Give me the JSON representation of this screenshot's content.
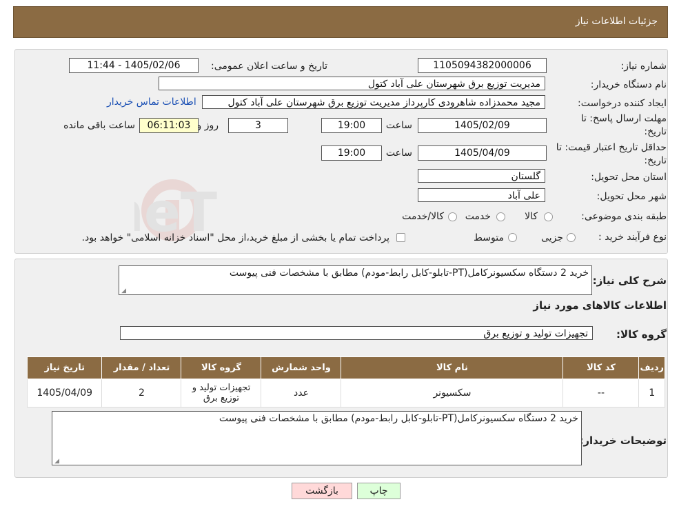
{
  "header": {
    "title": "جزئیات اطلاعات نیاز"
  },
  "fields": {
    "need_number_label": "شماره نیاز:",
    "need_number": "1105094382000006",
    "announce_label": "تاریخ و ساعت اعلان عمومی:",
    "announce_value": "1405/02/06 - 11:44",
    "buyer_org_label": "نام دستگاه خریدار:",
    "buyer_org": "مدیریت توزیع برق شهرستان علی آباد کتول",
    "requester_label": "ایجاد کننده درخواست:",
    "requester": "مجید محمدزاده شاهرودی کارپرداز مدیریت توزیع برق شهرستان علی آباد کتول",
    "contact_link": "اطلاعات تماس خریدار",
    "deadline_label_1": "مهلت ارسال پاسخ: تا",
    "deadline_label_2": "تاریخ:",
    "deadline_date": "1405/02/09",
    "time_label": "ساعت",
    "deadline_time": "19:00",
    "days_value": "3",
    "days_label": "روز و",
    "remaining_time": "06:11:03",
    "remaining_label": "ساعت باقی مانده",
    "validity_label_1": "حداقل تاریخ اعتبار قیمت: تا",
    "validity_label_2": "تاریخ:",
    "validity_date": "1405/04/09",
    "validity_time_label": "ساعت",
    "validity_time": "19:00",
    "province_label": "استان محل تحویل:",
    "province": "گلستان",
    "city_label": "شهر محل تحویل:",
    "city": "علی آباد",
    "category_label": "طبقه بندی موضوعی:",
    "category_options": [
      "کالا",
      "خدمت",
      "کالا/خدمت"
    ],
    "process_label": "نوع فرآیند خرید :",
    "process_options": [
      "جزیی",
      "متوسط"
    ],
    "process_note": "پرداخت تمام یا بخشی از مبلغ خرید،از محل \"اسناد خزانه اسلامی\" خواهد بود."
  },
  "summary": {
    "label": "شرح کلی نیاز:",
    "text": "خرید 2 دستگاه سکسیونرکامل(PT-تابلو-کابل رابط-مودم) مطابق با مشخصات فنی  پیوست"
  },
  "goods": {
    "section_title": "اطلاعات کالاهای مورد نیاز",
    "group_label": "گروه کالا:",
    "group_value": "تجهیزات تولید و توزیع برق",
    "columns": [
      "ردیف",
      "کد کالا",
      "نام کالا",
      "واحد شمارش",
      "گروه کالا",
      "تعداد / مقدار",
      "تاریخ نیاز"
    ],
    "rows": [
      [
        "1",
        "--",
        "سکسیونر",
        "عدد",
        "تجهیزات تولید و توزیع برق",
        "2",
        "1405/04/09"
      ]
    ]
  },
  "buyer_notes": {
    "label": "توضیحات خریدار:",
    "text": "خرید 2 دستگاه سکسیونرکامل(PT-تابلو-کابل رابط-مودم) مطابق با مشخصات فنی  پیوست"
  },
  "buttons": {
    "print": "چاپ",
    "back": "بازگشت"
  },
  "watermark": {
    "text": "AriaTender.neT"
  },
  "colors": {
    "header_bg": "#8b6b43",
    "print_btn": "#ddffd9",
    "back_btn": "#ffd9d9"
  }
}
